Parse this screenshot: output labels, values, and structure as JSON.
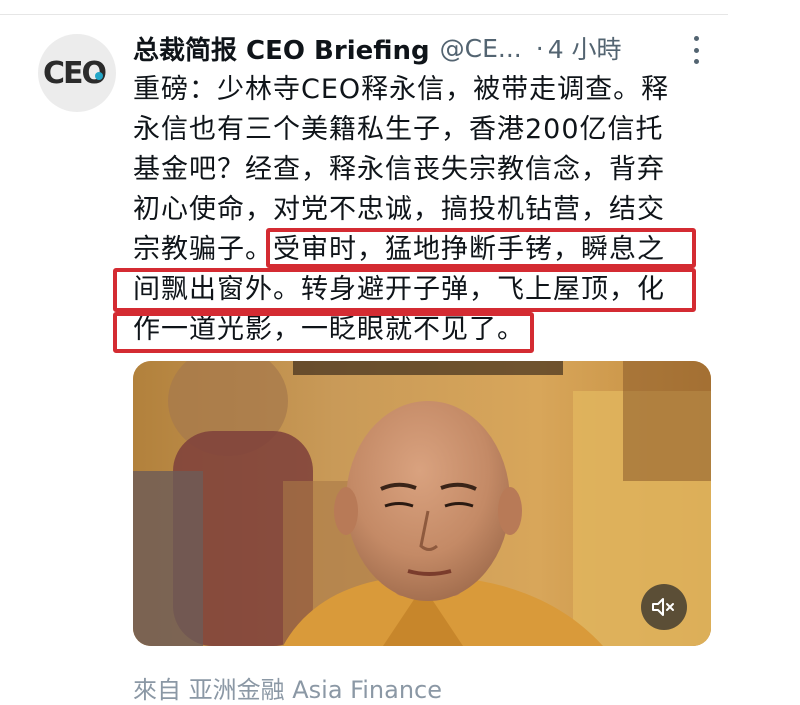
{
  "tweet": {
    "avatar_text": "CEO",
    "author_name": "总裁简报 CEO Briefing",
    "author_handle": "@CE...",
    "time_sep": "·",
    "time": "4 小時",
    "lines": [
      "重磅：少林寺CEO释永信，被带走调查。释",
      "永信也有三个美籍私生子，香港200亿信托",
      "基金吧？经查，释永信丧失宗教信念，背弃",
      "初心使命，对党不忠诚，搞投机钻营，结交",
      "宗教骗子。受审时，猛地挣断手铐，瞬息之",
      "间飘出窗外。转身避开子弹，飞上屋顶，化",
      "作一道光影，一眨眼就不见了。"
    ],
    "highlight_color": "#d42b32",
    "media_icon": "mute-icon",
    "source_footer": "來自 亚洲金融 Asia Finance"
  }
}
